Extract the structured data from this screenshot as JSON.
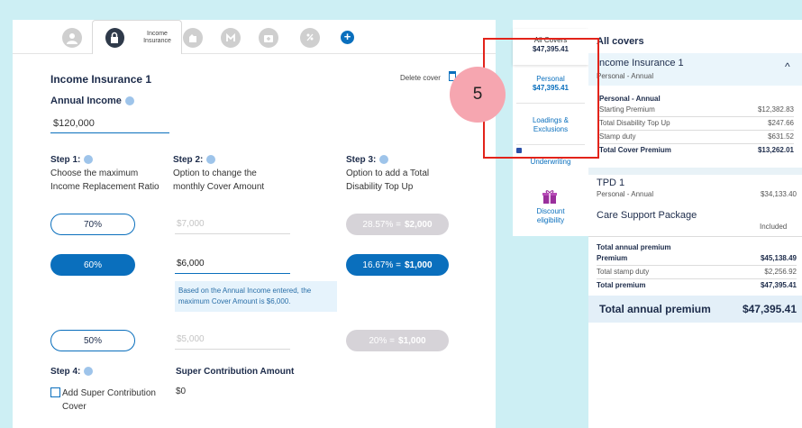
{
  "tabs": {
    "active_label": "Income Insurance",
    "icons": [
      "person-icon",
      "lock-icon",
      "hand-icon",
      "heart-hands-icon",
      "medical-case-icon",
      "percent-hand-icon",
      "plus-icon"
    ]
  },
  "cover": {
    "title": "Income Insurance 1",
    "delete_label": "Delete cover",
    "annual_income_label": "Annual Income",
    "annual_income_value": "$120,000"
  },
  "steps": {
    "step1": {
      "title": "Step 1:",
      "desc_line1": "Choose the maximum",
      "desc_line2": "Income Replacement Ratio"
    },
    "step2": {
      "title": "Step 2:",
      "desc_line1": "Option to change the",
      "desc_line2": "monthly Cover Amount"
    },
    "step3": {
      "title": "Step 3:",
      "desc_line1": "Option to add a Total",
      "desc_line2": "Disability Top Up"
    },
    "step4": {
      "title": "Step 4:"
    }
  },
  "options": [
    {
      "ratio": "70%",
      "amount": "$7,000",
      "topup_pct": "28.57% =",
      "topup_amt": "$2,000"
    },
    {
      "ratio": "60%",
      "amount": "$6,000",
      "topup_pct": "16.67% =",
      "topup_amt": "$1,000"
    },
    {
      "ratio": "50%",
      "amount": "$5,000",
      "topup_pct": "20% =",
      "topup_amt": "$1,000"
    }
  ],
  "note": "Based on the Annual Income entered, the maximum Cover Amount is $6,000.",
  "super": {
    "title": "Super Contribution Amount",
    "checkbox_label": "Add Super Contribution Cover",
    "value": "$0"
  },
  "nav": {
    "all_covers_label": "All Covers",
    "all_covers_amount": "$47,395.41",
    "personal_label": "Personal",
    "personal_amount": "$47,395.41",
    "loadings_label": "Loadings & Exclusions",
    "underwriting_label": "Underwriting",
    "discount_label": "Discount eligibility"
  },
  "badge": "5",
  "summary": {
    "title": "All covers",
    "cover_name": "Income Insurance 1",
    "cover_sub": "Personal - Annual",
    "detail_heading": "Personal - Annual",
    "rows": [
      {
        "label": "Starting Premium",
        "value": "$12,382.83"
      },
      {
        "label": "Total Disability Top Up",
        "value": "$247.66"
      },
      {
        "label": "Stamp duty",
        "value": "$631.52"
      }
    ],
    "total_cover_label": "Total Cover Premium",
    "total_cover_value": "$13,262.01",
    "tpd_name": "TPD 1",
    "tpd_sub": "Personal - Annual",
    "tpd_value": "$34,133.40",
    "care_name": "Care Support Package",
    "care_value": "Included",
    "totals_heading": "Total annual premium",
    "premium_label": "Premium",
    "premium_value": "$45,138.49",
    "stamp_label": "Total stamp duty",
    "stamp_value": "$2,256.92",
    "total_label": "Total premium",
    "total_value": "$47,395.41",
    "annual_label": "Total annual premium",
    "annual_value": "$47,395.41"
  },
  "colors": {
    "primary": "#0a6fbd",
    "highlight": "#e2231a",
    "badge": "#f6a6b0",
    "background": "#cdeff4"
  }
}
